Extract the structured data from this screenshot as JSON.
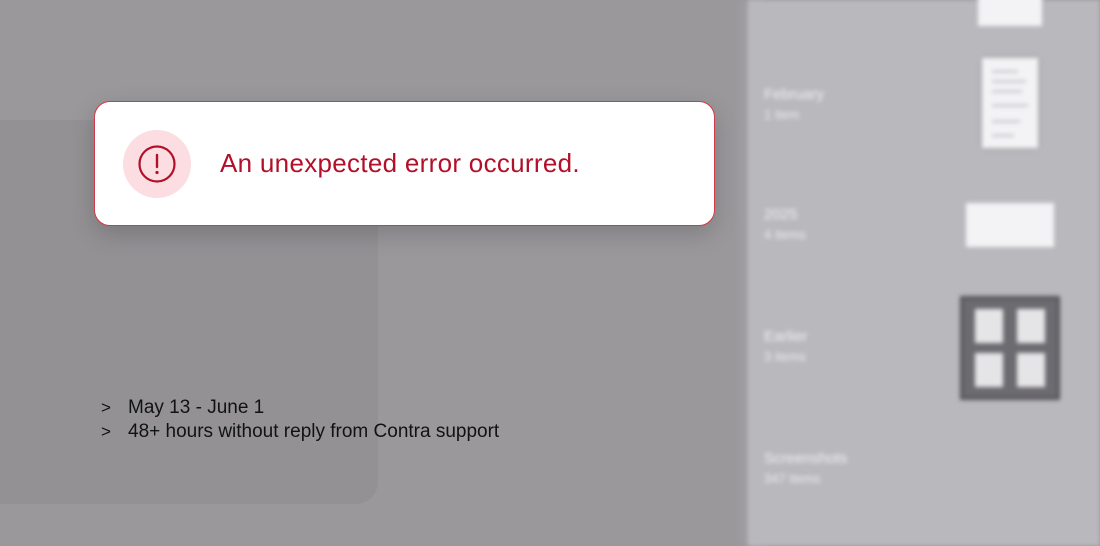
{
  "toast": {
    "message": "An unexpected error occurred.",
    "icon": "alert-circle-icon",
    "accent_color": "#b2102a",
    "border_color": "#d13a48",
    "icon_bg": "#fbdde2"
  },
  "notes": [
    {
      "marker": ">",
      "text": "May 13 - June 1"
    },
    {
      "marker": ">",
      "text": "48+ hours without reply from Contra support"
    }
  ],
  "sidebar": {
    "items": [
      {
        "name": "February",
        "count": "1 item"
      },
      {
        "name": "2025",
        "count": "4 items"
      },
      {
        "name": "Earlier",
        "count": "3 items"
      },
      {
        "name": "Screenshots",
        "count": "347 items"
      }
    ]
  }
}
